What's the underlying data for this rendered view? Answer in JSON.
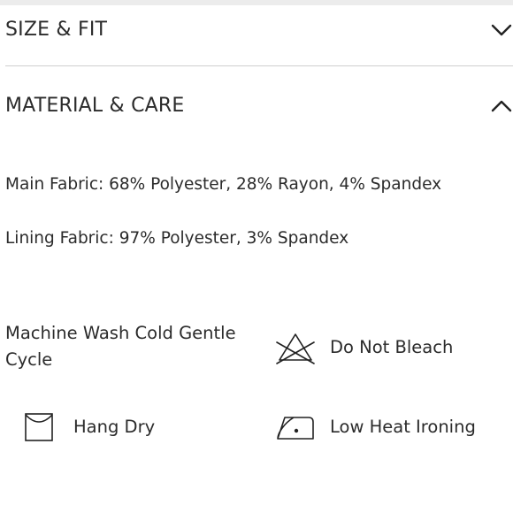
{
  "sections": {
    "size_fit": {
      "title": "SIZE & FIT",
      "expanded": false,
      "chevron_icon": "chevron-down-icon"
    },
    "material_care": {
      "title": "MATERIAL & CARE",
      "expanded": true,
      "chevron_icon": "chevron-up-icon"
    }
  },
  "material": {
    "main_fabric": "Main Fabric: 68% Polyester, 28% Rayon, 4% Spandex",
    "lining_fabric": "Lining Fabric: 97% Polyester, 3% Spandex"
  },
  "care": [
    {
      "label": "Machine Wash Cold Gentle Cycle",
      "icon": "none"
    },
    {
      "label": "Do Not Bleach",
      "icon": "do-not-bleach-icon"
    },
    {
      "label": "Hang Dry",
      "icon": "hang-dry-icon"
    },
    {
      "label": "Low Heat Ironing",
      "icon": "low-heat-iron-icon"
    }
  ]
}
